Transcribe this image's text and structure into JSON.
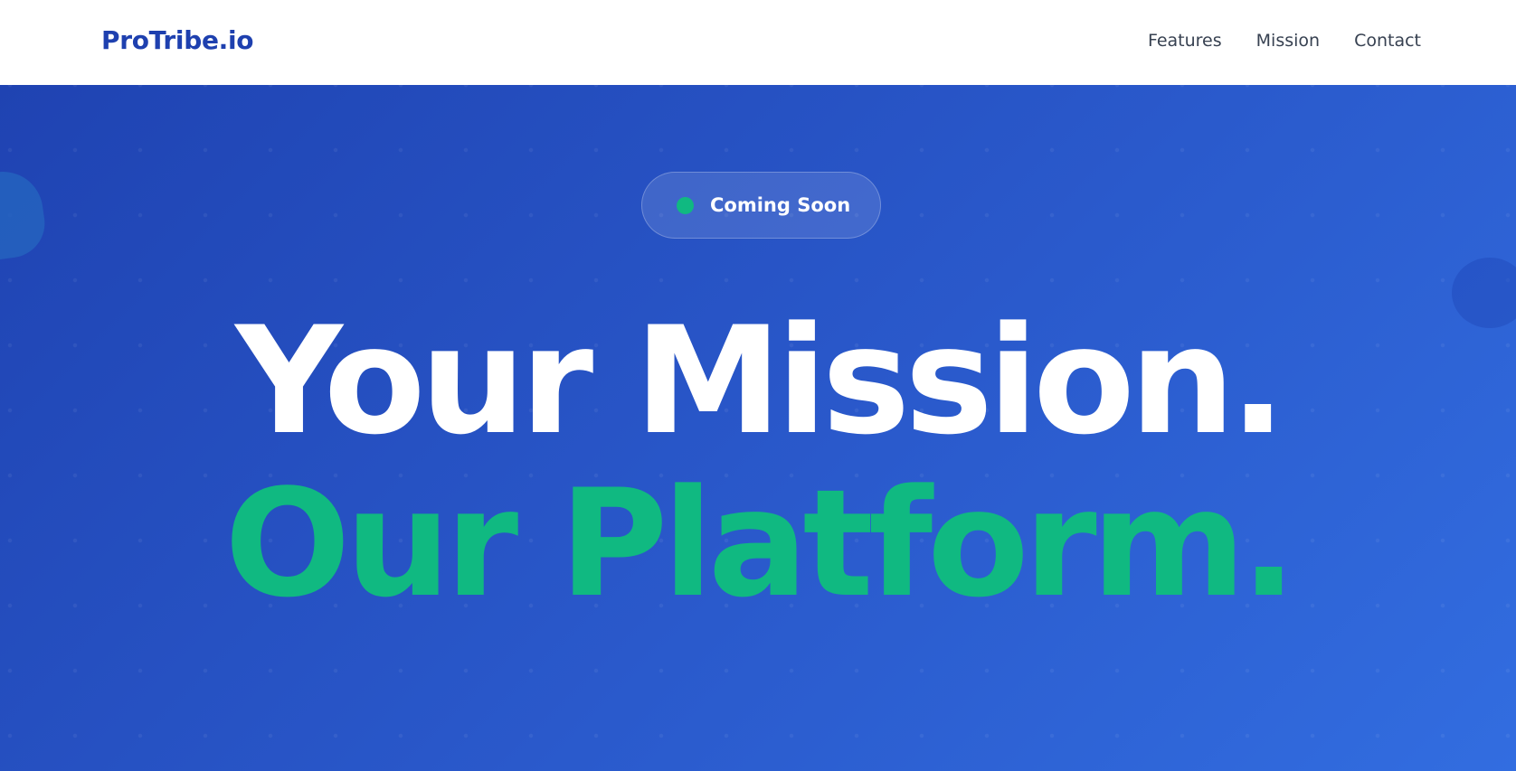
{
  "navbar": {
    "logo": "ProTribe.io",
    "links": [
      {
        "label": "Features"
      },
      {
        "label": "Mission"
      },
      {
        "label": "Contact"
      }
    ]
  },
  "hero": {
    "badge": {
      "text": "Coming Soon",
      "dot_color": "#10b981"
    },
    "headline_line1": "Your Mission.",
    "headline_line2": "Our Platform.",
    "colors": {
      "gradient_start": "#1f43b2",
      "gradient_end": "#326de0",
      "accent": "#10b981",
      "logo": "#1e40af"
    }
  }
}
